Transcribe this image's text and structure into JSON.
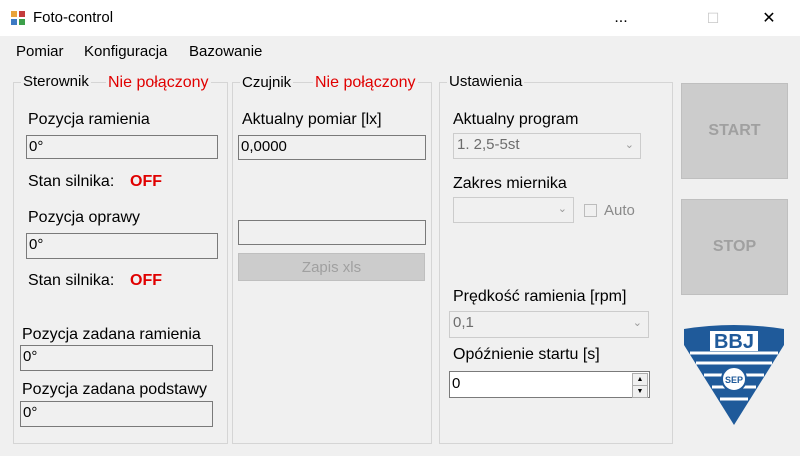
{
  "window": {
    "title": "Foto-control",
    "min_glyph": "...",
    "max_glyph": "☐",
    "close_glyph": "✕"
  },
  "menu": {
    "items": [
      "Pomiar",
      "Konfiguracja",
      "Bazowanie"
    ]
  },
  "sterownik": {
    "legend": "Sterownik",
    "status": "Nie połączony",
    "pozycja_ramienia_label": "Pozycja ramienia",
    "pozycja_ramienia_value": "0°",
    "stan_silnika_label_1": "Stan silnika:",
    "stan_silnika_value_1": "OFF",
    "pozycja_oprawy_label": "Pozycja oprawy",
    "pozycja_oprawy_value": "0°",
    "stan_silnika_label_2": "Stan silnika:",
    "stan_silnika_value_2": "OFF",
    "pozycja_zadana_ramienia_label": "Pozycja zadana ramienia",
    "pozycja_zadana_ramienia_value": "0°",
    "pozycja_zadana_podstawy_label": "Pozycja zadana podstawy",
    "pozycja_zadana_podstawy_value": "0°"
  },
  "czujnik": {
    "legend": "Czujnik",
    "status": "Nie połączony",
    "aktualny_pomiar_label": "Aktualny pomiar [lx]",
    "aktualny_pomiar_value": "0,0000",
    "filename_value": "",
    "zapis_button": "Zapis xls"
  },
  "ustawienia": {
    "legend": "Ustawienia",
    "aktualny_program_label": "Aktualny program",
    "aktualny_program_value": "1. 2,5-5st",
    "zakres_label": "Zakres miernika",
    "zakres_value": "",
    "auto_label": "Auto",
    "predkosc_label": "Prędkość ramienia [rpm]",
    "predkosc_value": "0,1",
    "opoznienie_label": "Opóźnienie startu [s]",
    "opoznienie_value": "0"
  },
  "buttons": {
    "start": "START",
    "stop": "STOP"
  },
  "logo": {
    "text": "BBJ",
    "seal": "SEP"
  }
}
